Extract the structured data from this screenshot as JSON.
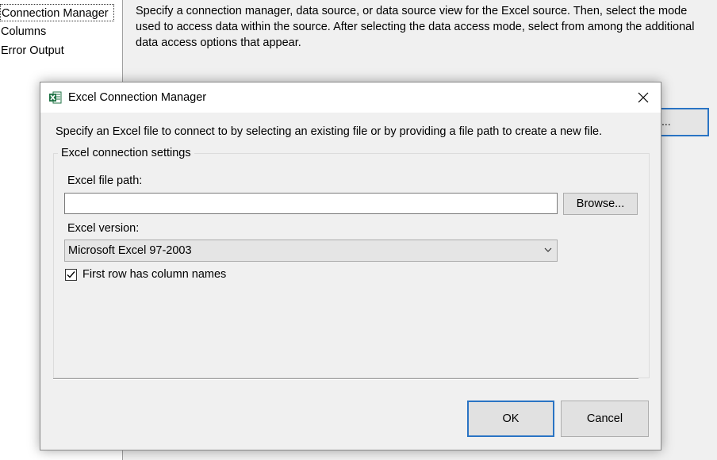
{
  "background": {
    "nav_items": [
      {
        "label": "Connection Manager"
      },
      {
        "label": "Columns"
      },
      {
        "label": "Error Output"
      }
    ],
    "description": "Specify a connection manager, data source, or data source view for the Excel source. Then, select the mode used to access data within the source. After selecting the data access mode, select from among the additional data access options that appear.",
    "button_label": "..."
  },
  "dialog": {
    "title": "Excel Connection Manager",
    "app_icon": "excel-icon",
    "close_icon": "close-icon",
    "intro": "Specify an Excel file to connect to by selecting an existing file or by providing a file path to create a new file.",
    "group_label": "Excel connection settings",
    "file_path_label": "Excel file path:",
    "file_path_value": "",
    "browse_label": "Browse...",
    "version_label": "Excel version:",
    "version_selected": "Microsoft Excel 97-2003",
    "first_row_label": "First row has column names",
    "first_row_checked": true,
    "ok_label": "OK",
    "cancel_label": "Cancel",
    "accent_color": "#2a74c4",
    "excel_green": "#217346"
  }
}
